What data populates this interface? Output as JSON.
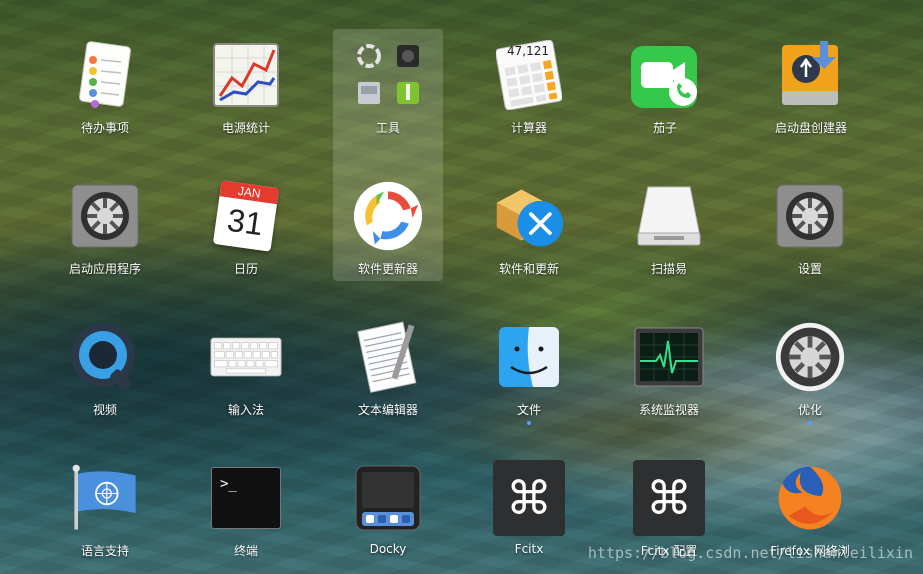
{
  "desktop": {
    "background": "coastal landscape wallpaper",
    "accent": "#4da3ff"
  },
  "apps": [
    {
      "label": "待办事项",
      "icon": "reminders-icon",
      "running": false
    },
    {
      "label": "电源统计",
      "icon": "power-statistics-icon",
      "running": false
    },
    {
      "label": "工具",
      "icon": "utilities-folder-icon",
      "running": false
    },
    {
      "label": "计算器",
      "icon": "calculator-icon",
      "running": false,
      "display": "47,121"
    },
    {
      "label": "茄子",
      "icon": "cheese-camera-icon",
      "running": false
    },
    {
      "label": "启动盘创建器",
      "icon": "startup-disk-creator-icon",
      "running": false
    },
    {
      "label": "启动应用程序",
      "icon": "startup-applications-icon",
      "running": false
    },
    {
      "label": "日历",
      "icon": "calendar-icon",
      "running": false,
      "calendar_month": "JAN",
      "calendar_day": "31"
    },
    {
      "label": "软件更新器",
      "icon": "software-updater-icon",
      "running": false
    },
    {
      "label": "软件和更新",
      "icon": "software-and-updates-icon",
      "running": false
    },
    {
      "label": "扫描易",
      "icon": "scanner-icon",
      "running": false
    },
    {
      "label": "设置",
      "icon": "settings-icon",
      "running": false
    },
    {
      "label": "视频",
      "icon": "videos-icon",
      "running": false
    },
    {
      "label": "输入法",
      "icon": "keyboard-input-method-icon",
      "running": false
    },
    {
      "label": "文本编辑器",
      "icon": "text-editor-icon",
      "running": false
    },
    {
      "label": "文件",
      "icon": "finder-files-icon",
      "running": true
    },
    {
      "label": "系统监视器",
      "icon": "system-monitor-icon",
      "running": false
    },
    {
      "label": "优化",
      "icon": "tweaks-icon",
      "running": true
    },
    {
      "label": "语言支持",
      "icon": "language-support-flag-icon",
      "running": false
    },
    {
      "label": "终端",
      "icon": "terminal-icon",
      "running": false,
      "prompt": ">_"
    },
    {
      "label": "Docky",
      "icon": "docky-icon",
      "running": false
    },
    {
      "label": "Fcitx",
      "icon": "command-key-icon",
      "running": false
    },
    {
      "label": "Fcitx 配置",
      "icon": "command-key-icon",
      "running": false
    },
    {
      "label": "Firefox 网络浏",
      "icon": "firefox-icon",
      "running": false
    }
  ],
  "watermark": "https://blog.csdn.net/lishanleilixin"
}
